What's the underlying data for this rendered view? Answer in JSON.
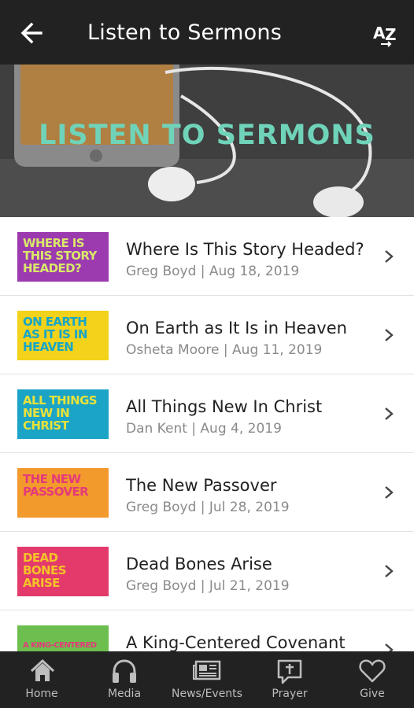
{
  "appbar": {
    "title": "Listen to Sermons",
    "back_icon": "arrow-left-icon",
    "sort_icon": "sort-az-icon"
  },
  "hero": {
    "text": "LISTEN TO SERMONS",
    "text_color": "#6fd3b9"
  },
  "sermons": [
    {
      "thumb_text": "Where is this story headed?",
      "thumb_bg": "#9c3ab0",
      "thumb_fg": "#d9e86a",
      "title": "Where Is This Story Headed?",
      "meta": "Greg Boyd | Aug 18, 2019"
    },
    {
      "thumb_text": "On earth as it is in heaven",
      "thumb_bg": "#f2d21b",
      "thumb_fg": "#17a6c7",
      "title": "On Earth as It Is in Heaven",
      "meta": "Osheta Moore | Aug 11, 2019"
    },
    {
      "thumb_text": "All things new in Christ",
      "thumb_bg": "#1ba4c6",
      "thumb_fg": "#e8e23a",
      "title": "All Things New In Christ",
      "meta": "Dan Kent | Aug 4, 2019"
    },
    {
      "thumb_text": "The new passover",
      "thumb_bg": "#f39a2d",
      "thumb_fg": "#e43a7a",
      "title": "The New Passover",
      "meta": "Greg Boyd | Jul 28, 2019"
    },
    {
      "thumb_text": "Dead bones arise",
      "thumb_bg": "#e33a6b",
      "thumb_fg": "#f5c328",
      "title": "Dead Bones Arise",
      "meta": "Greg Boyd | Jul 21, 2019"
    },
    {
      "thumb_text": "A king-centered",
      "thumb_bg": "#6cbf4e",
      "thumb_fg": "#e43a7a",
      "title": "A King-Centered Covenant",
      "meta": ""
    }
  ],
  "bottom_nav": [
    {
      "label": "Home",
      "icon": "home-icon"
    },
    {
      "label": "Media",
      "icon": "headphones-icon"
    },
    {
      "label": "News/Events",
      "icon": "newspaper-icon"
    },
    {
      "label": "Prayer",
      "icon": "prayer-icon"
    },
    {
      "label": "Give",
      "icon": "heart-icon"
    }
  ]
}
